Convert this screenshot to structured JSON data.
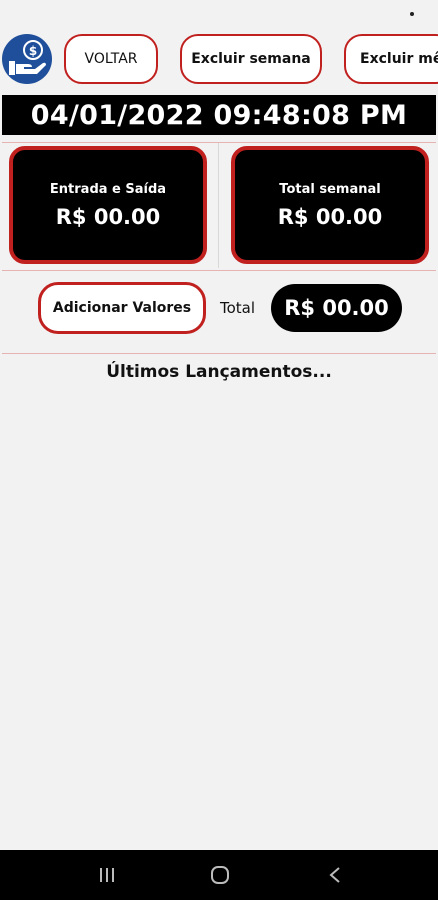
{
  "toolbar": {
    "back_label": "VOLTAR",
    "delete_week_label": "Excluir semana",
    "delete_month_label": "Excluir mês"
  },
  "datetime": "04/01/2022 09:48:08 PM",
  "cards": {
    "in_out": {
      "title": "Entrada e Saída",
      "value": "R$ 00.00"
    },
    "weekly": {
      "title": "Total semanal",
      "value": "R$ 00.00"
    }
  },
  "actions": {
    "add_values_label": "Adicionar Valores",
    "total_label": "Total",
    "total_value": "R$ 00.00"
  },
  "section": {
    "title": "Últimos Lançamentos..."
  },
  "icons": {
    "app_logo": "money-hand-icon",
    "nav_recents": "recents-icon",
    "nav_home": "home-icon",
    "nav_back": "back-icon"
  },
  "colors": {
    "accent_red": "#c0211f",
    "logo_blue": "#1f4f9b",
    "background": "#f2f2f2",
    "dark": "#000000"
  }
}
